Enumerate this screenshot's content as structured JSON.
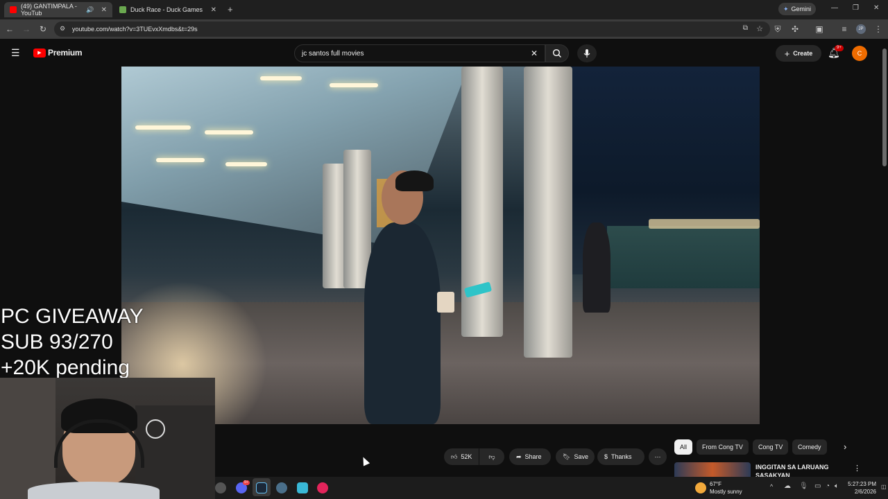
{
  "browser": {
    "tabs": [
      {
        "label": "(49) GANTIMPALA - YouTub",
        "active": true
      },
      {
        "label": "Duck Race - Duck Games",
        "active": false
      }
    ],
    "new_tab_symbol": "+",
    "gemini_label": "Gemini",
    "url": "youtube.com/watch?v=3TUEvxXmdbs&t=29s",
    "profile_initials": "JP"
  },
  "youtube": {
    "logo_label": "Premium",
    "search_value": "jc santos full movies",
    "create_label": "Create",
    "notification_badge": "9+",
    "avatar_initial": "C",
    "colors": {
      "brand_red": "#ff0000",
      "avatar_orange": "#ef6c00"
    }
  },
  "overlay": {
    "line1": "PC GIVEAWAY",
    "line2": "SUB 93/270",
    "line3": "+20K pending"
  },
  "actions": {
    "like_count": "52K",
    "share_label": "Share",
    "save_label": "Save",
    "thanks_label": "Thanks"
  },
  "chips": [
    "All",
    "From Cong TV",
    "Cong TV",
    "Comedy"
  ],
  "recommendation": {
    "title": "INGGITAN SA LARUANG",
    "title_line2": "SASAKYAN"
  },
  "taskbar": {
    "weather_temp": "67°F",
    "weather_desc": "Mostly sunny",
    "time": "5:27:23 PM",
    "date": "2/6/2026",
    "discord_badge": "9+"
  }
}
